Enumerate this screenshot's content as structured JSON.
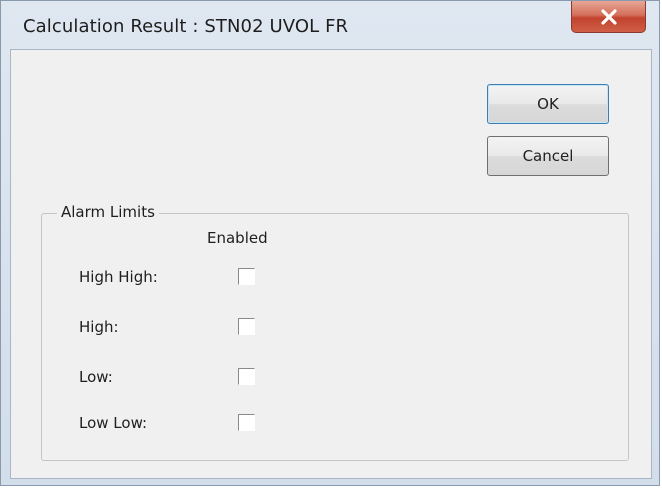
{
  "window": {
    "title": "Calculation Result : STN02 UVOL FR",
    "close_icon": "close-x-icon"
  },
  "buttons": {
    "ok_label": "OK",
    "cancel_label": "Cancel"
  },
  "alarm_limits": {
    "group_label": "Alarm Limits",
    "column_header": "Enabled",
    "rows": [
      {
        "label": "High High:",
        "enabled": false
      },
      {
        "label": "High:",
        "enabled": false
      },
      {
        "label": "Low:",
        "enabled": false
      },
      {
        "label": "Low Low:",
        "enabled": false
      }
    ]
  }
}
